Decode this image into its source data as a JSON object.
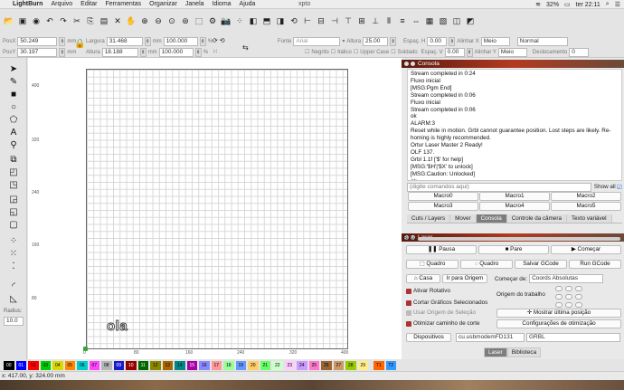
{
  "menubar": {
    "app": "LightBurn",
    "items": [
      "Arquivo",
      "Editar",
      "Ferramentas",
      "Organizar",
      "Janela",
      "Idioma",
      "Ajuda"
    ],
    "window_title": "xpto",
    "battery": "32%",
    "clock": "ter 22:11"
  },
  "props": {
    "posx_label": "PosX",
    "posx": "50.249",
    "posy_label": "PosY",
    "posy": "30.197",
    "unit": "mm",
    "largura_label": "Largura",
    "largura": "31.468",
    "altura_label": "Altura",
    "altura": "18.188",
    "scale1": "100.000",
    "scale2": "100.000",
    "pct": "%",
    "fonte_label": "Fonte",
    "fonte": "Arial",
    "altura2_label": "Altura",
    "altura2": "25.00",
    "esph_label": "Espaç. H",
    "esph": "0.00",
    "espv_label": "Espaç. V",
    "espv": "0.00",
    "alinhx_label": "Alinhar X",
    "alinhx": "Meio",
    "alinhy_label": "Alinhar Y",
    "alinhy": "Meio",
    "normal": "Normal",
    "negrito": "Negrito",
    "italico": "Itálico",
    "upper": "Upper Case",
    "soldado": "Soldado",
    "desloc_label": "Deslocamento",
    "desloc": "0"
  },
  "ruler": {
    "left": [
      "400",
      "320",
      "240",
      "160",
      "80"
    ],
    "bottom": [
      "0",
      "80",
      "160",
      "240",
      "320",
      "400"
    ]
  },
  "canvas": {
    "text": "ola"
  },
  "radius": {
    "label": "Radius:",
    "value": "10.0"
  },
  "console": {
    "title": "Consola",
    "lines": [
      "Stream completed in 0:24",
      "Fluxo inicial",
      "[MSG:Pgm End]",
      "Stream completed in 0:06",
      "Fluxo inicial",
      "Stream completed in 0:06",
      "ok",
      "ALARM:3",
      "Reset while in motion. Grbl cannot guarantee position. Lost steps are likely. Re-",
      "homing is highly recommended.",
      "Ortur Laser Master 2 Ready!",
      "OLF 137.",
      "Grbl 1.1f ['$' for help]",
      "[MSG:'$H'|'$X' to unlock]",
      "[MSG:Caution: Unlocked]",
      "ok"
    ],
    "placeholder": "(digite comandos aqui)",
    "show_all": "Show all",
    "macros": [
      "Macro0",
      "Macro1",
      "Macro2",
      "Macro3",
      "Macro4",
      "Macro5"
    ]
  },
  "tabs": [
    "Cuts / Layers",
    "Mover",
    "Consola",
    "Controle da câmera",
    "Texto variável"
  ],
  "laser": {
    "title": "Laser",
    "status": "Busy",
    "pausa": "Pausa",
    "pare": "Pare",
    "comecar": "Começar",
    "quadro1": "Quadro",
    "quadro2": "Quadro",
    "salvar": "Salvar GCode",
    "run": "Run GCode",
    "casa": "Casa",
    "ir_origem": "Ir para Origem",
    "comecar_de_label": "Começar de:",
    "comecar_de": "Coords Absolutas",
    "ativar_rotativo": "Ativar Rotativo",
    "origem_label": "Origem do trabalho",
    "cortar": "Cortar Gráficos Selecionados",
    "usar_origem": "Usar Origem de Seleção",
    "mostrar": "Mostrar última posição",
    "otimizar": "Otimizar caminho de corte",
    "config": "Configurações de otimização",
    "dispositivos": "Dispositivos",
    "porta": "cu.usbmodemFD131",
    "grbl": "GRBL"
  },
  "bottom_tabs": [
    "Laser",
    "Biblioteca"
  ],
  "palette": [
    {
      "label": "00",
      "color": "#000000"
    },
    {
      "label": "01",
      "color": "#0000ff"
    },
    {
      "label": "02",
      "color": "#ff0000"
    },
    {
      "label": "03",
      "color": "#00cc00"
    },
    {
      "label": "04",
      "color": "#d9d900"
    },
    {
      "label": "05",
      "color": "#ff8800"
    },
    {
      "label": "06",
      "color": "#00cccc"
    },
    {
      "label": "07",
      "color": "#ff44ff"
    },
    {
      "label": "08",
      "color": "#b5b5b5"
    },
    {
      "label": "09",
      "color": "#1a1acc"
    },
    {
      "label": "10",
      "color": "#990000"
    },
    {
      "label": "11",
      "color": "#006600"
    },
    {
      "label": "12",
      "color": "#888800"
    },
    {
      "label": "13",
      "color": "#aa6600"
    },
    {
      "label": "14",
      "color": "#008888"
    },
    {
      "label": "15",
      "color": "#aa00aa"
    },
    {
      "label": "16",
      "color": "#8888ff"
    },
    {
      "label": "17",
      "color": "#ff9999"
    },
    {
      "label": "18",
      "color": "#99ff99"
    },
    {
      "label": "19",
      "color": "#6699ff"
    },
    {
      "label": "20",
      "color": "#ffcc66"
    },
    {
      "label": "21",
      "color": "#66ff66"
    },
    {
      "label": "22",
      "color": "#ccffcc"
    },
    {
      "label": "23",
      "color": "#ffccff"
    },
    {
      "label": "24",
      "color": "#cc99ff"
    },
    {
      "label": "25",
      "color": "#ff77cc"
    },
    {
      "label": "26",
      "color": "#996633"
    },
    {
      "label": "27",
      "color": "#cc9966"
    },
    {
      "label": "28",
      "color": "#99cc00"
    },
    {
      "label": "29",
      "color": "#ffee88"
    },
    {
      "label": "T1",
      "color": "#ff6600"
    },
    {
      "label": "T2",
      "color": "#3399ff"
    }
  ],
  "status": "x: 417.00, y: 324.00 mm"
}
